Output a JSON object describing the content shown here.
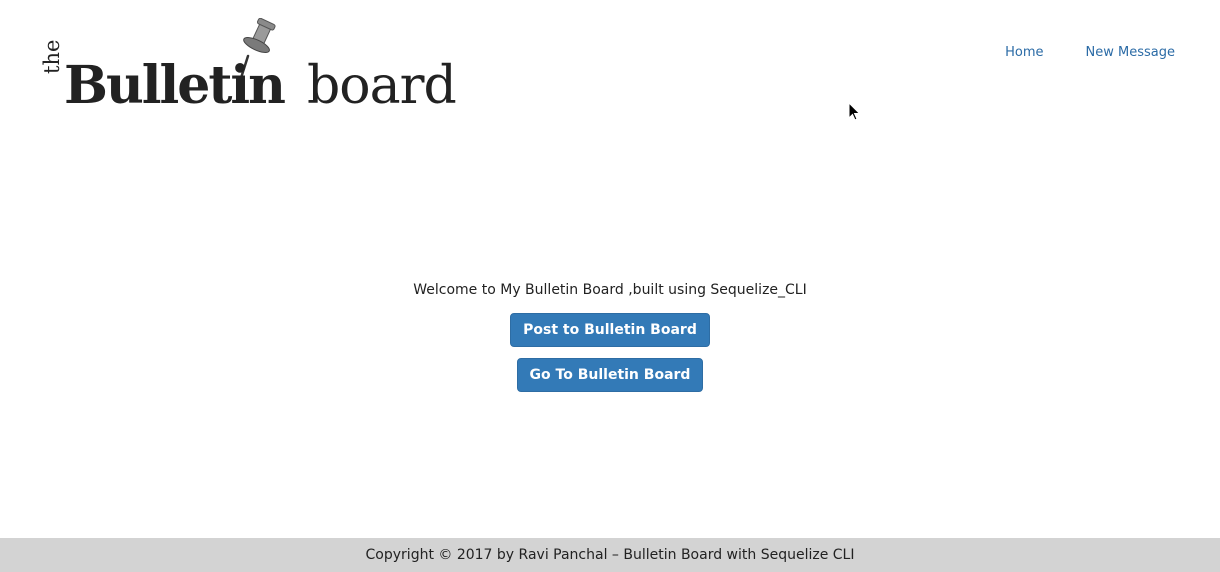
{
  "logo": {
    "the": "the",
    "bulletin": "Bulletin",
    "board": "board"
  },
  "nav": {
    "items": [
      {
        "label": "Home"
      },
      {
        "label": "New Message"
      }
    ]
  },
  "main": {
    "welcome": "Welcome to My Bulletin Board ,built using Sequelize_CLI",
    "post_button": "Post to Bulletin Board",
    "go_button": "Go To Bulletin Board"
  },
  "footer": {
    "text": "Copyright © 2017 by Ravi Panchal – Bulletin Board with Sequelize CLI"
  },
  "colors": {
    "link": "#2b6ba6",
    "button": "#337ab7",
    "footer_bg": "#d3d3d3"
  }
}
